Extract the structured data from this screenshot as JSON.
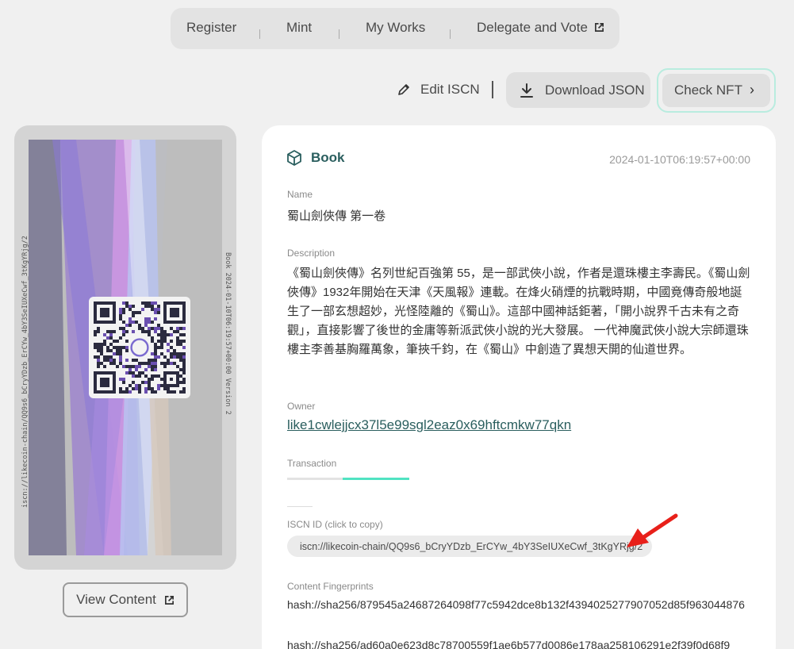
{
  "topnav": {
    "items": [
      {
        "label": "Register"
      },
      {
        "label": "Mint"
      },
      {
        "label": "My Works"
      },
      {
        "label": "Delegate and Vote",
        "external": true
      }
    ]
  },
  "actions": {
    "edit_label": "Edit ISCN",
    "download_label": "Download JSON",
    "check_label": "Check NFT"
  },
  "nft_card": {
    "side_left_text": "iscn://likecoin-chain/QQ9s6_bCryYDzb_ErCYw_4bY3SeIUXeCwf_3tKgYRjg/2",
    "side_right_text": "Book 2024-01-10T06:19:57+00:00 Version 2",
    "view_content_label": "View Content"
  },
  "record": {
    "type": "Book",
    "date": "2024-01-10T06:19:57+00:00",
    "name_label": "Name",
    "name": "蜀山劍俠傳 第一卷",
    "description_label": "Description",
    "description": "《蜀山劍俠傳》名列世紀百強第 55，是一部武俠小說，作者是還珠樓主李壽民。《蜀山劍俠傳》1932年開始在天津《天風報》連載。在烽火硝煙的抗戰時期，中國竟傳奇般地誕生了一部玄想超妙，光怪陸離的《蜀山》。這部中國神話鉅著，「開小說界千古未有之奇觀」，直接影響了後世的金庸等新派武俠小說的光大發展。 一代神魔武俠小說大宗師還珠樓主李善基胸羅萬象，筆挾千鈞，在《蜀山》中創造了異想天開的仙道世界。",
    "owner_label": "Owner",
    "owner": "like1cwlejjcx37l5e99sgl2eaz0x69hftcmkw77qkn",
    "transaction_label": "Transaction",
    "iscn_id_label": "ISCN ID (click to copy)",
    "iscn_id": "iscn://likecoin-chain/QQ9s6_bCryYDzb_ErCYw_4bY3SeIUXeCwf_3tKgYRjg/2",
    "fingerprints_label": "Content Fingerprints",
    "fingerprints": [
      "hash://sha256/879545a24687264098f77c5942dce8b132f4394025277907052d85f963044876",
      "hash://sha256/ad60a0e623d8c78700559f1ae6b577d0086e178aa258106291e2f39f0d68f9"
    ]
  },
  "colors": {
    "accent_teal": "#2a5e5e",
    "accent_green": "#50e3c2",
    "annotation_red": "#e8201a"
  }
}
